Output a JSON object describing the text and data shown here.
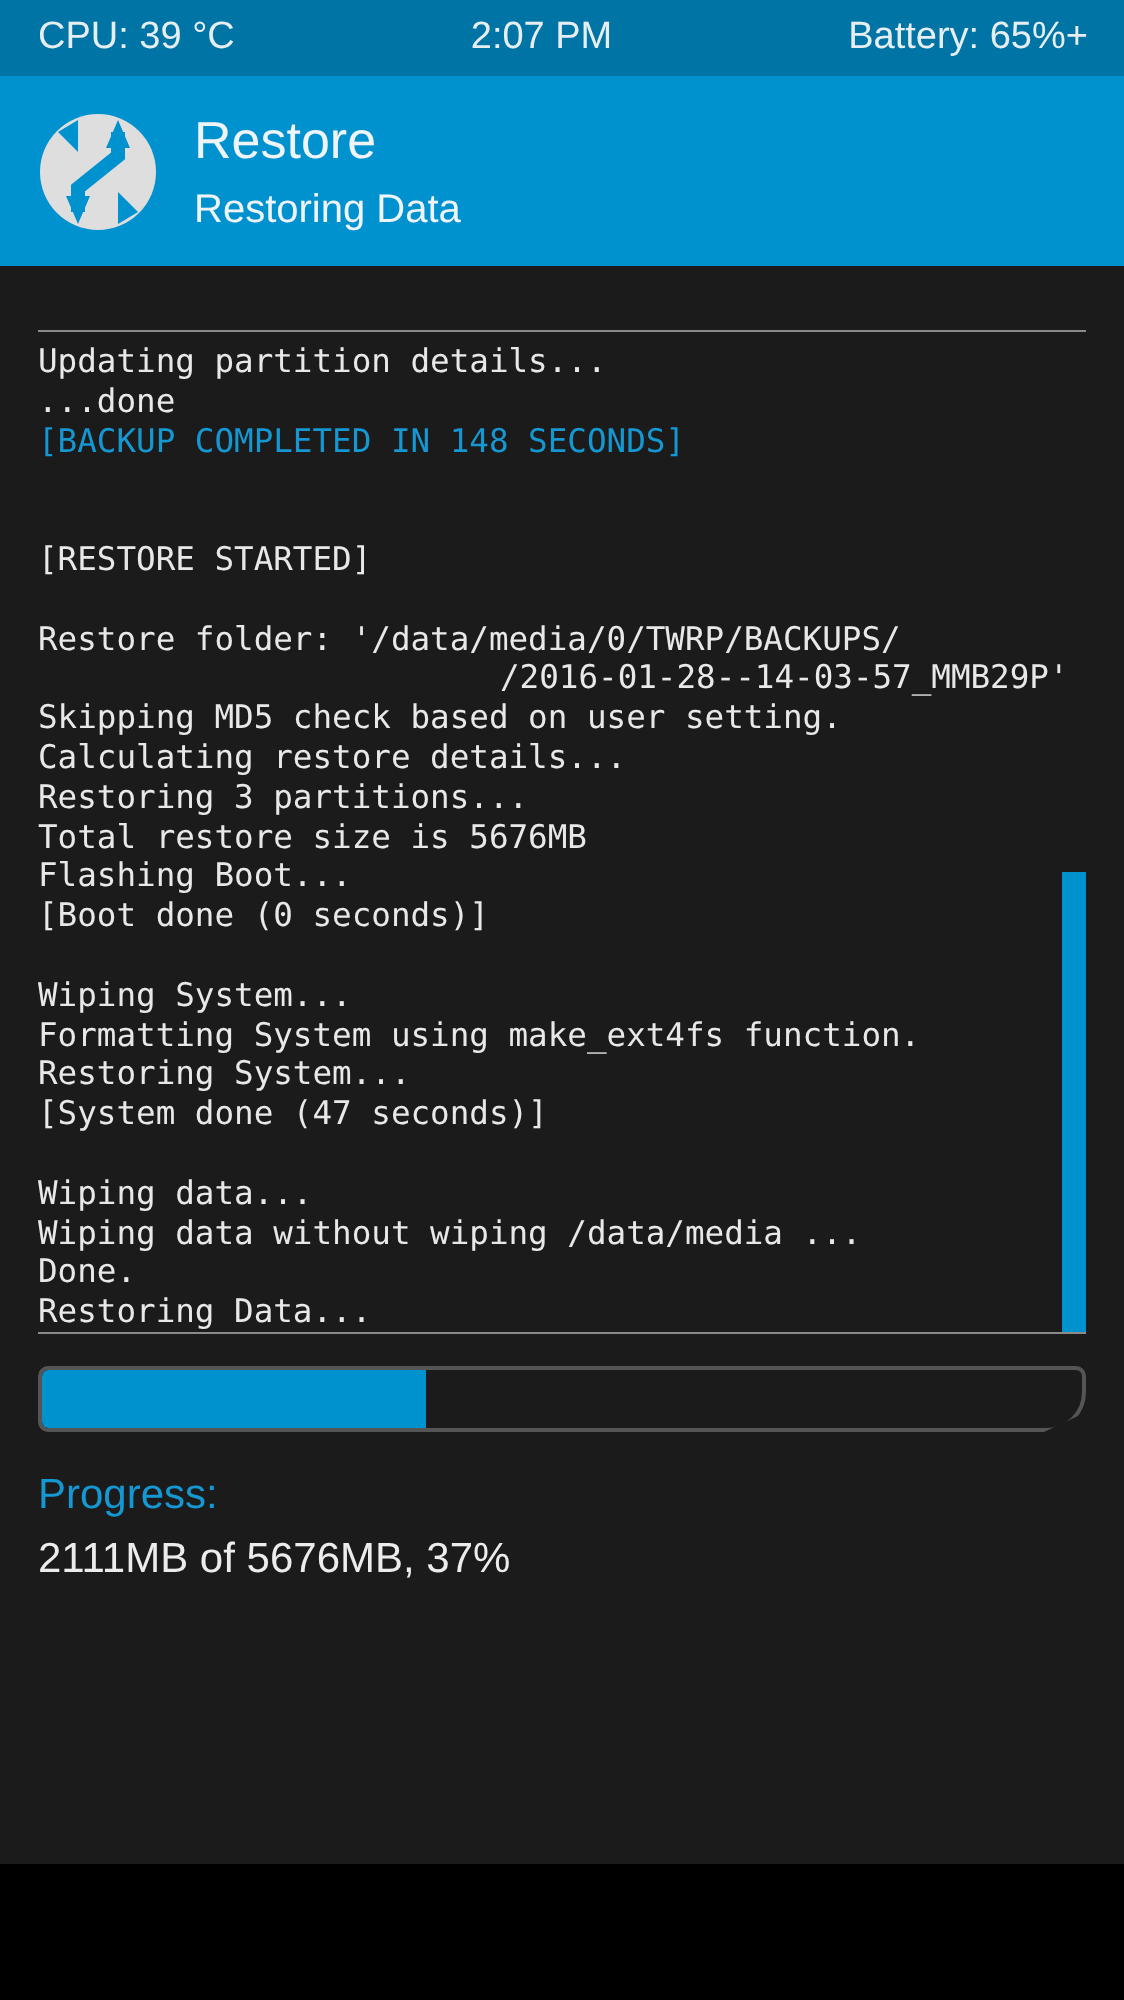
{
  "status_bar": {
    "cpu": "CPU: 39 °C",
    "time": "2:07 PM",
    "battery": "Battery: 65%+"
  },
  "header": {
    "title": "Restore",
    "subtitle": "Restoring Data"
  },
  "console": {
    "blocks": [
      {
        "gap_before": false,
        "wide_gap": false,
        "lines": [
          {
            "kind": "plain",
            "text": "Updating partition details..."
          },
          {
            "kind": "plain",
            "text": "...done"
          },
          {
            "kind": "accent",
            "text": "[BACKUP COMPLETED IN 148 SECONDS]"
          }
        ]
      },
      {
        "gap_before": true,
        "wide_gap": true,
        "lines": [
          {
            "kind": "plain",
            "text": "[RESTORE STARTED]"
          }
        ]
      },
      {
        "gap_before": true,
        "wide_gap": false,
        "lines": [
          {
            "kind": "plain",
            "text": "Restore folder: '/data/media/0/TWRP/BACKUPS/"
          },
          {
            "kind": "indent",
            "text": "/2016-01-28--14-03-57_MMB29P'"
          },
          {
            "kind": "plain",
            "text": "Skipping MD5 check based on user setting."
          },
          {
            "kind": "plain",
            "text": "Calculating restore details..."
          },
          {
            "kind": "plain",
            "text": "Restoring 3 partitions..."
          },
          {
            "kind": "plain",
            "text": "Total restore size is 5676MB"
          },
          {
            "kind": "plain",
            "text": "Flashing Boot..."
          },
          {
            "kind": "plain",
            "text": "[Boot done (0 seconds)]"
          }
        ]
      },
      {
        "gap_before": true,
        "wide_gap": false,
        "lines": [
          {
            "kind": "plain",
            "text": "Wiping System..."
          },
          {
            "kind": "plain",
            "text": "Formatting System using make_ext4fs function."
          },
          {
            "kind": "plain",
            "text": "Restoring System..."
          },
          {
            "kind": "plain",
            "text": "[System done (47 seconds)]"
          }
        ]
      },
      {
        "gap_before": true,
        "wide_gap": false,
        "lines": [
          {
            "kind": "plain",
            "text": "Wiping data..."
          },
          {
            "kind": "plain",
            "text": "Wiping data without wiping /data/media ..."
          },
          {
            "kind": "plain",
            "text": "Done."
          },
          {
            "kind": "plain",
            "text": "Restoring Data..."
          }
        ]
      }
    ]
  },
  "progress": {
    "level": 0.37,
    "label": "Progress:",
    "reading": "2111MB of 5676MB, 37%"
  }
}
